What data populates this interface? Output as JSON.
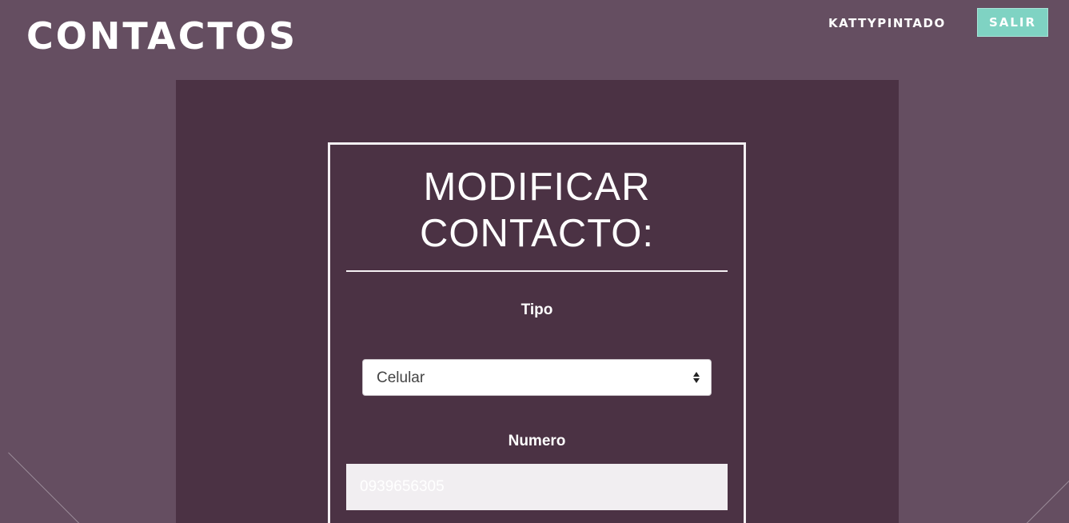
{
  "header": {
    "brand": "CONTACTOS",
    "username": "KATTYPINTADO",
    "logout_label": "SALIR"
  },
  "form": {
    "title_line1": "MODIFICAR",
    "title_line2": "CONTACTO:",
    "tipo_label": "Tipo",
    "tipo_selected": "Celular",
    "numero_label": "Numero",
    "numero_value": "0939656305"
  },
  "colors": {
    "background": "#654e61",
    "panel": "#4b3244",
    "accent_button": "#7fd3c3"
  },
  "icons": {
    "select_arrows": "select-updown-icon"
  }
}
